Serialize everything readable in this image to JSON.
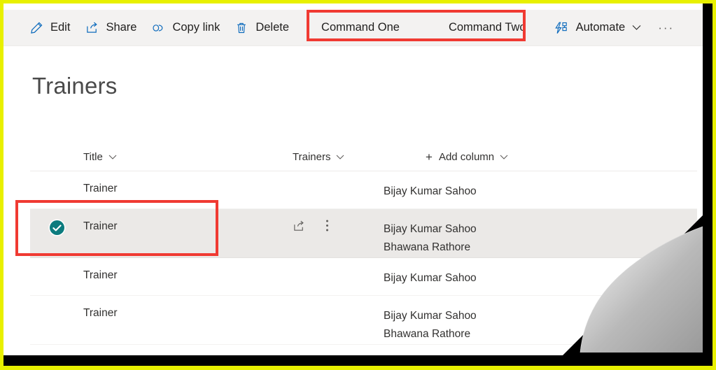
{
  "window": {
    "border_color": "#e8f000",
    "page_edge_color": "#000000"
  },
  "command_bar": {
    "background": "#f3f2f1",
    "items": [
      {
        "id": "edit",
        "label": "Edit",
        "icon": "pencil-icon"
      },
      {
        "id": "share",
        "label": "Share",
        "icon": "share-icon"
      },
      {
        "id": "copy-link",
        "label": "Copy link",
        "icon": "link-icon"
      },
      {
        "id": "delete",
        "label": "Delete",
        "icon": "trash-icon"
      }
    ],
    "custom_commands": [
      {
        "id": "command-one",
        "label": "Command One"
      },
      {
        "id": "command-two",
        "label": "Command Two"
      }
    ],
    "automate": {
      "label": "Automate",
      "icon": "automate-icon",
      "caret": "chevron-down-icon"
    },
    "overflow": {
      "label": "···"
    }
  },
  "highlights": {
    "color": "#f03a32",
    "command_group_note": "Command One / Command Two",
    "selected_row_note": "selected list row"
  },
  "header": {
    "title": "Trainers"
  },
  "list": {
    "columns": [
      {
        "id": "title",
        "label": "Title",
        "has_caret": true
      },
      {
        "id": "trainers",
        "label": "Trainers",
        "has_caret": true
      },
      {
        "id": "add-column",
        "label": "Add column",
        "has_caret": true,
        "has_plus": true
      }
    ],
    "rows": [
      {
        "title": "Trainer",
        "trainers": [
          "Bijay Kumar Sahoo"
        ],
        "selected": false,
        "show_actions": false
      },
      {
        "title": "Trainer",
        "trainers": [
          "Bijay Kumar Sahoo",
          "Bhawana Rathore"
        ],
        "selected": true,
        "show_actions": true,
        "actions": [
          {
            "id": "share-row",
            "icon": "share-icon"
          },
          {
            "id": "more-row",
            "icon": "ellipsis-vertical-icon"
          }
        ]
      },
      {
        "title": "Trainer",
        "trainers": [
          "Bijay Kumar Sahoo"
        ],
        "selected": false,
        "show_actions": false
      },
      {
        "title": "Trainer",
        "trainers": [
          "Bijay Kumar Sahoo",
          "Bhawana Rathore"
        ],
        "selected": false,
        "show_actions": false
      }
    ],
    "selection_indicator_color": "#0c7b7e"
  }
}
